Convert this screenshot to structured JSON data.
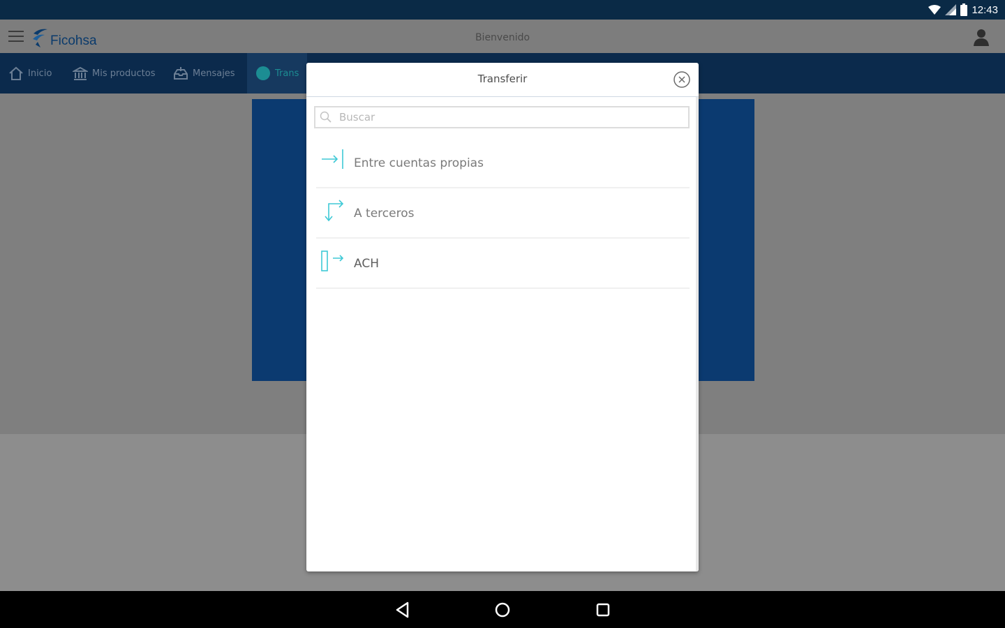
{
  "status_bar": {
    "time": "12:43"
  },
  "header": {
    "brand": "Ficohsa",
    "welcome": "Bienvenido"
  },
  "nav": {
    "items": [
      {
        "label": "Inicio",
        "icon": "home-icon"
      },
      {
        "label": "Mis productos",
        "icon": "bank-icon"
      },
      {
        "label": "Mensajes",
        "icon": "inbox-icon"
      },
      {
        "label": "Trans",
        "icon": "transfer-icon"
      }
    ]
  },
  "modal": {
    "title": "Transferir",
    "search": {
      "placeholder": "Buscar",
      "value": ""
    },
    "options": [
      {
        "label": "Entre cuentas propias",
        "icon": "arrow-to-bar-icon"
      },
      {
        "label": "A terceros",
        "icon": "branch-arrow-icon"
      },
      {
        "label": "ACH",
        "icon": "ach-transfer-icon"
      }
    ]
  },
  "colors": {
    "status_bar": "#0a2a46",
    "nav_bar": "#0b2a4c",
    "brand_blue": "#0b3b6c",
    "icon_cyan": "#3ec9d6"
  }
}
